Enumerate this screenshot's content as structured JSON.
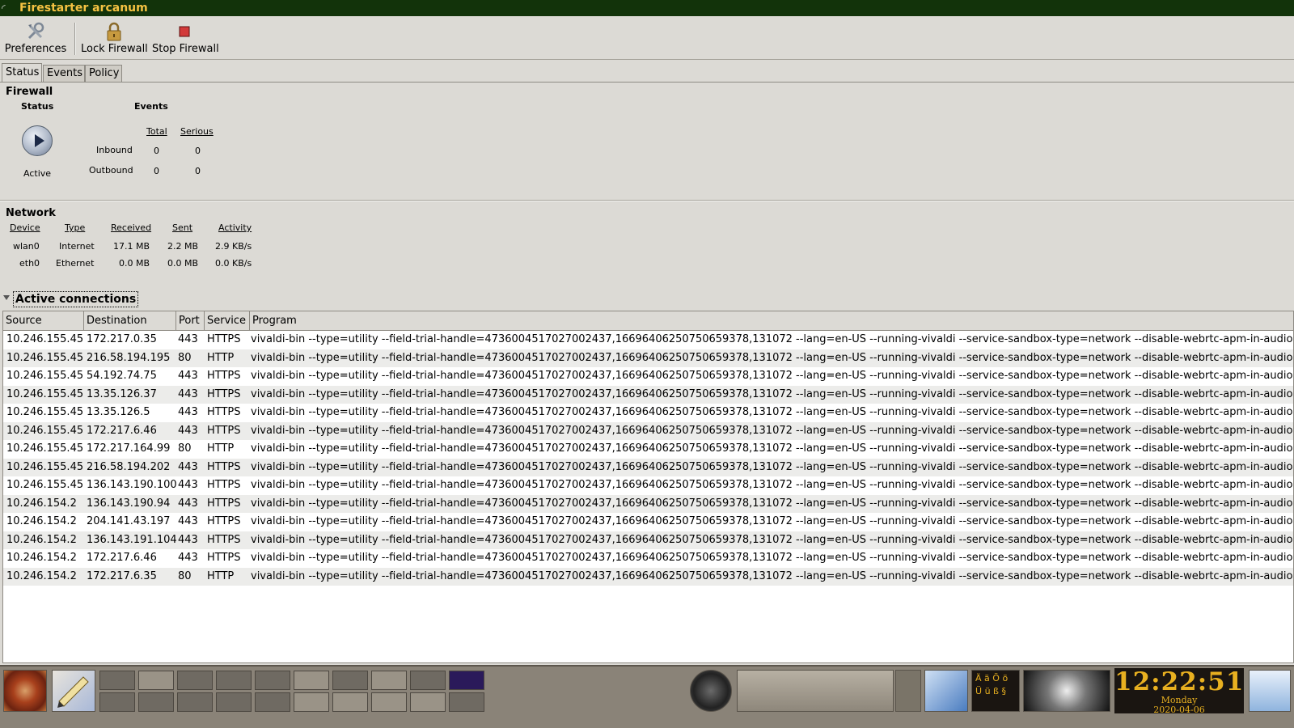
{
  "window": {
    "title": "Firestarter arcanum"
  },
  "toolbar": {
    "preferences_label": "Preferences",
    "lock_label": "Lock Firewall",
    "stop_label": "Stop Firewall"
  },
  "tabs": [
    "Status",
    "Events",
    "Policy"
  ],
  "firewall": {
    "heading": "Firewall",
    "status_heading": "Status",
    "status_text": "Active",
    "events_heading": "Events",
    "col_total": "Total",
    "col_serious": "Serious",
    "rows": [
      {
        "label": "Inbound",
        "total": "0",
        "serious": "0"
      },
      {
        "label": "Outbound",
        "total": "0",
        "serious": "0"
      }
    ]
  },
  "network": {
    "heading": "Network",
    "columns": [
      "Device",
      "Type",
      "Received",
      "Sent",
      "Activity"
    ],
    "rows": [
      {
        "device": "wlan0",
        "type": "Internet",
        "received": "17.1 MB",
        "sent": "2.2 MB",
        "activity": "2.9 KB/s"
      },
      {
        "device": "eth0",
        "type": "Ethernet",
        "received": "0.0 MB",
        "sent": "0.0 MB",
        "activity": "0.0 KB/s"
      }
    ]
  },
  "connections": {
    "expander_label": "Active connections",
    "columns": [
      "Source",
      "Destination",
      "Port",
      "Service",
      "Program"
    ],
    "program": "vivaldi-bin --type=utility --field-trial-handle=4736004517027002437,16696406250750659378,131072 --lang=en-US --running-vivaldi --service-sandbox-type=network --disable-webrtc-apm-in-audio-serv",
    "rows": [
      {
        "source": "10.246.155.45",
        "destination": "172.217.0.35",
        "port": "443",
        "service": "HTTPS"
      },
      {
        "source": "10.246.155.45",
        "destination": "216.58.194.195",
        "port": "80",
        "service": "HTTP"
      },
      {
        "source": "10.246.155.45",
        "destination": "54.192.74.75",
        "port": "443",
        "service": "HTTPS"
      },
      {
        "source": "10.246.155.45",
        "destination": "13.35.126.37",
        "port": "443",
        "service": "HTTPS"
      },
      {
        "source": "10.246.155.45",
        "destination": "13.35.126.5",
        "port": "443",
        "service": "HTTPS"
      },
      {
        "source": "10.246.155.45",
        "destination": "172.217.6.46",
        "port": "443",
        "service": "HTTPS"
      },
      {
        "source": "10.246.155.45",
        "destination": "172.217.164.99",
        "port": "80",
        "service": "HTTP"
      },
      {
        "source": "10.246.155.45",
        "destination": "216.58.194.202",
        "port": "443",
        "service": "HTTPS"
      },
      {
        "source": "10.246.155.45",
        "destination": "136.143.190.100",
        "port": "443",
        "service": "HTTPS"
      },
      {
        "source": "10.246.154.2",
        "destination": "136.143.190.94",
        "port": "443",
        "service": "HTTPS"
      },
      {
        "source": "10.246.154.2",
        "destination": "204.141.43.197",
        "port": "443",
        "service": "HTTPS"
      },
      {
        "source": "10.246.154.2",
        "destination": "136.143.191.104",
        "port": "443",
        "service": "HTTPS"
      },
      {
        "source": "10.246.154.2",
        "destination": "172.217.6.46",
        "port": "443",
        "service": "HTTPS"
      },
      {
        "source": "10.246.154.2",
        "destination": "172.217.6.35",
        "port": "80",
        "service": "HTTP"
      }
    ]
  },
  "keyboard_panel": {
    "chars": [
      "Ä",
      "ä",
      "Ö",
      "ö",
      "Ü",
      "ü",
      "ß",
      "§"
    ]
  },
  "clock": {
    "time": "12:22:51",
    "day": "Monday",
    "date": "2020-04-06"
  },
  "colors": {
    "title_bg": "#12330a",
    "title_fg": "#f5c242",
    "clock_fg": "#e8b020"
  }
}
